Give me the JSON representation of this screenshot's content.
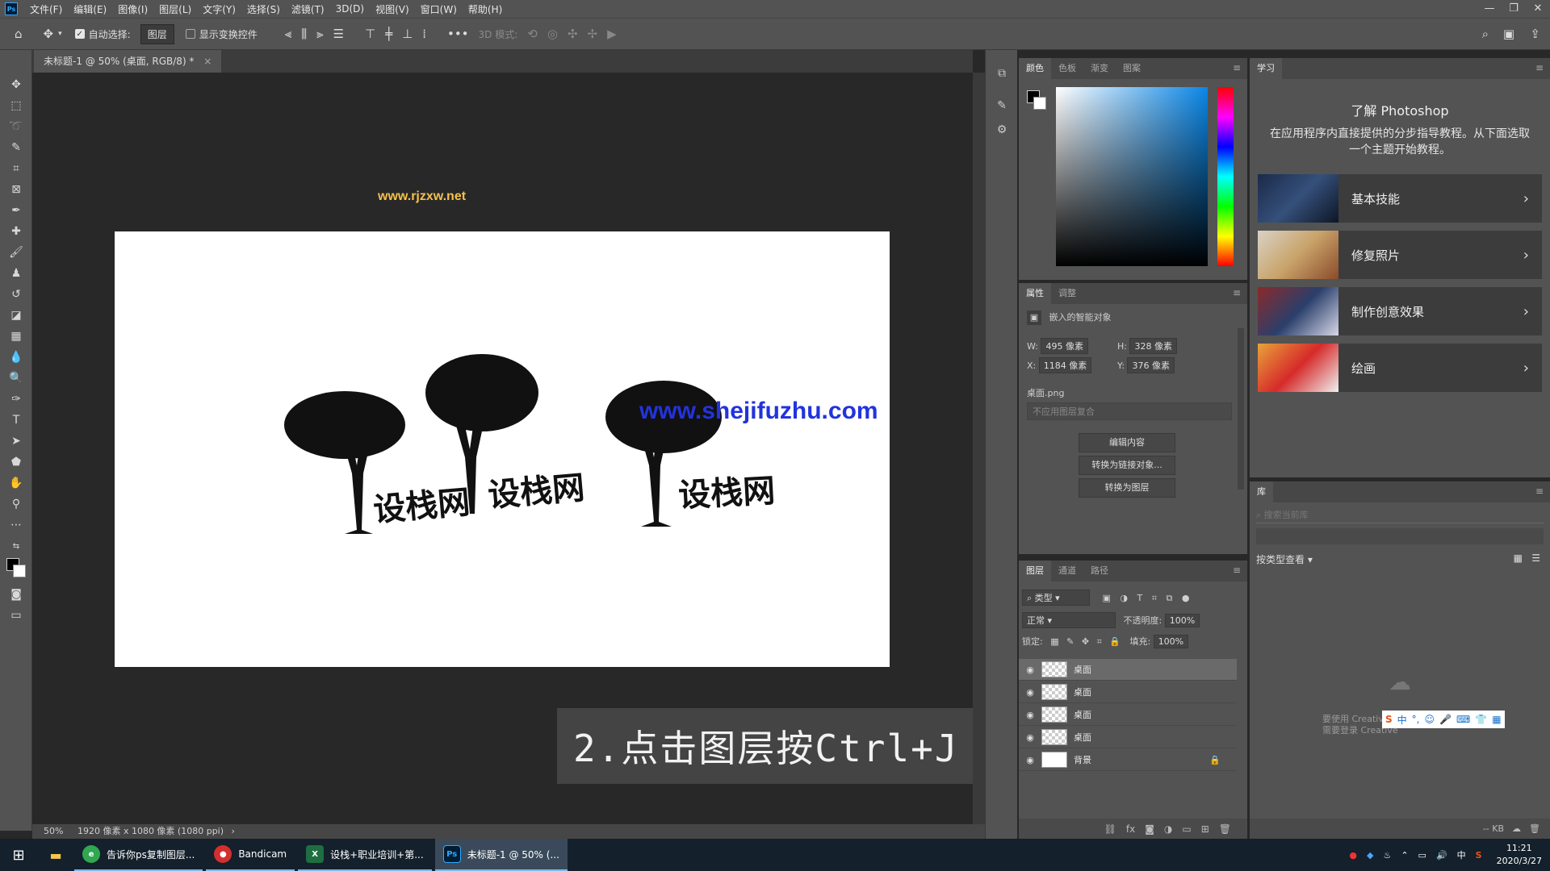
{
  "menubar": {
    "logo": "Ps",
    "items": [
      "文件(F)",
      "编辑(E)",
      "图像(I)",
      "图层(L)",
      "文字(Y)",
      "选择(S)",
      "滤镜(T)",
      "3D(D)",
      "视图(V)",
      "窗口(W)",
      "帮助(H)"
    ]
  },
  "options": {
    "auto_select_label": "自动选择:",
    "auto_select_value": "图层",
    "show_transform_label": "显示变换控件",
    "mode_3d_label": "3D 模式:"
  },
  "document": {
    "tab_title": "未标题-1 @ 50% (桌面, RGB/8) *",
    "status_zoom": "50%",
    "status_info": "1920 像素 x 1080 像素 (1080 ppi)",
    "watermark_top": "www.rjzxw.net",
    "watermark_blue": "www.shejifuzhu.com",
    "tree_words": [
      "设栈网",
      "设栈网",
      "设栈网"
    ],
    "caption": "2.点击图层按Ctrl+J"
  },
  "color_panel": {
    "tabs": [
      "颜色",
      "色板",
      "渐变",
      "图案"
    ]
  },
  "properties": {
    "tabs": [
      "属性",
      "调整"
    ],
    "object_type": "嵌入的智能对象",
    "w_label": "W:",
    "w_value": "495 像素",
    "h_label": "H:",
    "h_value": "328 像素",
    "x_label": "X:",
    "x_value": "1184 像素",
    "y_label": "Y:",
    "y_value": "376 像素",
    "filename": "桌面.png",
    "comp_placeholder": "不应用图层复合",
    "buttons": [
      "编辑内容",
      "转换为链接对象...",
      "转换为图层"
    ]
  },
  "layers": {
    "tabs": [
      "图层",
      "通道",
      "路径"
    ],
    "filter_label": "类型",
    "blend_mode": "正常",
    "opacity_label": "不透明度:",
    "opacity_value": "100%",
    "lock_label": "锁定:",
    "fill_label": "填充:",
    "fill_value": "100%",
    "rows": [
      {
        "name": "桌面",
        "selected": true
      },
      {
        "name": "桌面",
        "selected": false
      },
      {
        "name": "桌面",
        "selected": false
      },
      {
        "name": "桌面",
        "selected": false
      },
      {
        "name": "背景",
        "selected": false
      }
    ]
  },
  "learn": {
    "tab": "学习",
    "title": "了解 Photoshop",
    "description": "在应用程序内直接提供的分步指导教程。从下面选取一个主题开始教程。",
    "cards": [
      "基本技能",
      "修复照片",
      "制作创意效果",
      "绘画"
    ]
  },
  "library": {
    "tab": "库",
    "search_placeholder": "搜索当前库",
    "view_by": "按类型查看",
    "login_line1": "要使用 Creative",
    "login_line2": "需要登录 Creative",
    "size": "-- KB"
  },
  "taskbar": {
    "items": [
      {
        "label": "告诉你ps复制图层...",
        "icon": "e",
        "color": "#2fa84f"
      },
      {
        "label": "Bandicam",
        "icon": "●",
        "color": "#d32f2f"
      },
      {
        "label": "设栈+职业培训+第...",
        "icon": "X",
        "color": "#1d6f42"
      },
      {
        "label": "未标题-1 @ 50% (...",
        "icon": "Ps",
        "color": "#001d34"
      }
    ],
    "ime": "中",
    "time": "11:21",
    "date": "2020/3/27"
  }
}
